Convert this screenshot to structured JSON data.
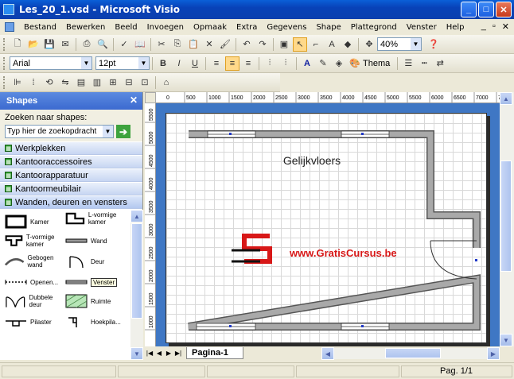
{
  "window": {
    "title": "Les_20_1.vsd - Microsoft Visio"
  },
  "menu": {
    "items": [
      "Bestand",
      "Bewerken",
      "Beeld",
      "Invoegen",
      "Opmaak",
      "Extra",
      "Gegevens",
      "Shape",
      "Plattegrond",
      "Venster",
      "Help"
    ]
  },
  "toolbar": {
    "zoom": "40%",
    "font": "Arial",
    "size": "12pt",
    "theme_label": "Thema"
  },
  "panel": {
    "title": "Shapes",
    "search_label": "Zoeken naar shapes:",
    "search_placeholder": "Typ hier de zoekopdracht",
    "stencils": [
      "Werkplekken",
      "Kantooraccessoires",
      "Kantoorapparatuur",
      "Kantoormeubilair",
      "Wanden, deuren en vensters"
    ],
    "shapes": [
      {
        "label": "Kamer"
      },
      {
        "label": "L-vormige kamer"
      },
      {
        "label": "T-vormige kamer"
      },
      {
        "label": "Wand"
      },
      {
        "label": "Gebogen wand"
      },
      {
        "label": "Deur"
      },
      {
        "label": "Openen..."
      },
      {
        "label": "Venster"
      },
      {
        "label": "Dubbele deur"
      },
      {
        "label": "Ruimte"
      },
      {
        "label": "Pilaster"
      },
      {
        "label": "Hoekpila..."
      }
    ]
  },
  "ruler": {
    "h_ticks": [
      "500",
      "1000",
      "1500",
      "2000",
      "2500",
      "3000",
      "3500",
      "4000",
      "4500",
      "5000",
      "5500",
      "6000",
      "6500",
      "7000",
      "75"
    ],
    "h_origin": "0",
    "v_ticks": [
      "5500",
      "5000",
      "4500",
      "4000",
      "3500",
      "3000",
      "2500",
      "2000",
      "1500",
      "1000"
    ]
  },
  "drawing": {
    "room_label": "Gelijkvloers",
    "watermark_text": "www.GratisCursus.be"
  },
  "tabs": {
    "page_tab": "Pagina-1"
  },
  "status": {
    "page": "Pag. 1/1"
  }
}
